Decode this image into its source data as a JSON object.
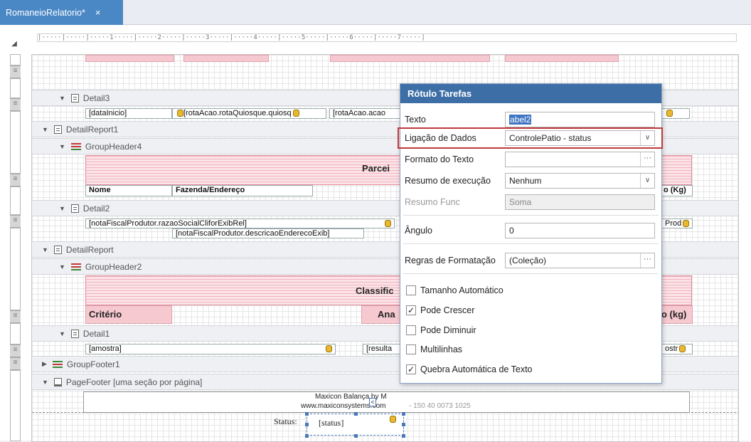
{
  "tab": {
    "title": "RomaneioRelatorio*",
    "close": "×"
  },
  "ruler": {
    "text": "|·····|·····|·····1·····|·····2·····|·····3·····|·····4·····|·····5·····|·····6·····|·····7·····|"
  },
  "bands": {
    "detail3": "Detail3",
    "detailreport1": "DetailReport1",
    "groupheader4": "GroupHeader4",
    "detail2": "Detail2",
    "detailreport": "DetailReport",
    "groupheader2": "GroupHeader2",
    "detail1": "Detail1",
    "groupfooter1": "GroupFooter1",
    "pagefooter": "PageFooter [uma seção por página]"
  },
  "cells": {
    "dataInicio": "[dataInicio]",
    "rotaQuiosque": "[rotaAcao.rotaQuiosque.quiosq",
    "rotaAcao2": "[rotaAcao.acao",
    "parceiro": "Parcei",
    "nome": "Nome",
    "fazenda": "Fazenda/Endereço",
    "pesoKg": "o (Kg)",
    "razaoSocial": "[notaFiscalProdutor.razaoSocialCliforExibRel]",
    "descricaoEndereco": "[notaFiscalProdutor.descricaoEnderecoExib]",
    "prod": "Prod",
    "classific": "Classific",
    "criterio": "Critério",
    "ana": "Ana",
    "pesoKg2": "o (kg)",
    "amostra": "[amostra]",
    "resulta": "[resulta",
    "ostr": "ostr",
    "footer1": "Maxicon Balança by M",
    "footer2": "www.maxiconsystems.com",
    "footer2tail": "- 150 40 0073 1025",
    "statusLabel": "Status:",
    "statusField": "[status]"
  },
  "popup": {
    "title": "Rótulo Tarefas",
    "texto_label": "Texto",
    "texto_value": "abel2",
    "ligacao_label": "Ligação de Dados",
    "ligacao_value": "ControlePatio - status",
    "formato_label": "Formato do Texto",
    "formato_value": "",
    "resumo_label": "Resumo de execução",
    "resumo_value": "Nenhum",
    "resumofunc_label": "Resumo Func",
    "resumofunc_value": "Soma",
    "angulo_label": "Ângulo",
    "angulo_value": "0",
    "regras_label": "Regras de Formatação",
    "regras_value": "(Coleção)",
    "ellipsis": "···",
    "chevron": "∨",
    "checks": [
      {
        "label": "Tamanho Automático",
        "checked": false
      },
      {
        "label": "Pode Crescer",
        "checked": true
      },
      {
        "label": "Pode Diminuir",
        "checked": false
      },
      {
        "label": "Multilinhas",
        "checked": false
      },
      {
        "label": "Quebra Automática de Texto",
        "checked": true
      }
    ]
  },
  "colors": {
    "tab": "#4a87c5",
    "popup_title": "#3d6fa6",
    "highlight": "#c0393b",
    "band_pink": "#f6c9d1"
  }
}
